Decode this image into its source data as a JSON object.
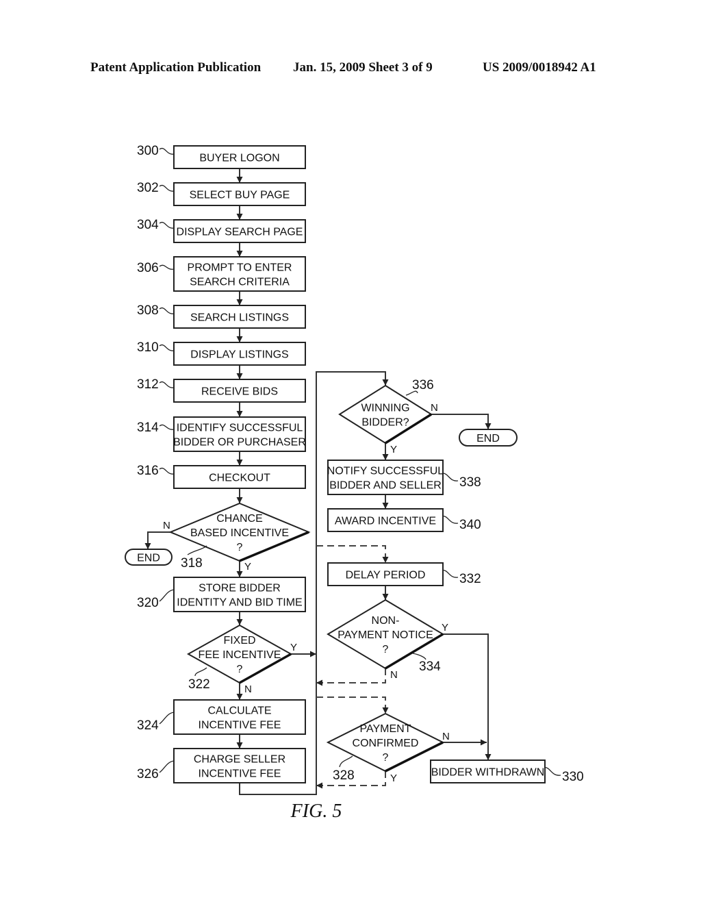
{
  "header": {
    "publication": "Patent Application Publication",
    "date_sheet": "Jan. 15, 2009   Sheet 3 of 9",
    "patent_number": "US 2009/0018942 A1"
  },
  "figure_label": "FIG. 5",
  "nodes": [
    {
      "id": "300",
      "type": "process",
      "lines": [
        "BUYER LOGON"
      ]
    },
    {
      "id": "302",
      "type": "process",
      "lines": [
        "SELECT BUY PAGE"
      ]
    },
    {
      "id": "304",
      "type": "process",
      "lines": [
        "DISPLAY SEARCH PAGE"
      ]
    },
    {
      "id": "306",
      "type": "process",
      "lines": [
        "PROMPT TO ENTER",
        "SEARCH CRITERIA"
      ]
    },
    {
      "id": "308",
      "type": "process",
      "lines": [
        "SEARCH LISTINGS"
      ]
    },
    {
      "id": "310",
      "type": "process",
      "lines": [
        "DISPLAY LISTINGS"
      ]
    },
    {
      "id": "312",
      "type": "process",
      "lines": [
        "RECEIVE BIDS"
      ]
    },
    {
      "id": "314",
      "type": "process",
      "lines": [
        "IDENTIFY SUCCESSFUL",
        "BIDDER OR PURCHASER"
      ]
    },
    {
      "id": "316",
      "type": "process",
      "lines": [
        "CHECKOUT"
      ]
    },
    {
      "id": "318",
      "type": "decision",
      "lines": [
        "CHANCE",
        "BASED INCENTIVE",
        "?"
      ]
    },
    {
      "id": "320",
      "type": "process",
      "lines": [
        "STORE BIDDER",
        "IDENTITY AND BID TIME"
      ]
    },
    {
      "id": "322",
      "type": "decision",
      "lines": [
        "FIXED",
        "FEE INCENTIVE",
        "?"
      ]
    },
    {
      "id": "324",
      "type": "process",
      "lines": [
        "CALCULATE",
        "INCENTIVE FEE"
      ]
    },
    {
      "id": "326",
      "type": "process",
      "lines": [
        "CHARGE SELLER",
        "INCENTIVE FEE"
      ]
    },
    {
      "id": "336",
      "type": "decision",
      "lines": [
        "WINNING",
        "BIDDER?"
      ]
    },
    {
      "id": "338",
      "type": "process",
      "lines": [
        "NOTIFY SUCCESSFUL",
        "BIDDER AND SELLER"
      ]
    },
    {
      "id": "340",
      "type": "process",
      "lines": [
        "AWARD INCENTIVE"
      ]
    },
    {
      "id": "332",
      "type": "process",
      "lines": [
        "DELAY PERIOD"
      ]
    },
    {
      "id": "334",
      "type": "decision",
      "lines": [
        "NON-",
        "PAYMENT NOTICE",
        "?"
      ]
    },
    {
      "id": "328",
      "type": "decision",
      "lines": [
        "PAYMENT",
        "CONFIRMED",
        "?"
      ]
    },
    {
      "id": "330",
      "type": "process",
      "lines": [
        "BIDDER WITHDRAWN"
      ]
    },
    {
      "id": "end-1",
      "type": "terminal",
      "lines": [
        "END"
      ]
    },
    {
      "id": "end-2",
      "type": "terminal",
      "lines": [
        "END"
      ]
    }
  ],
  "branch_labels": {
    "yes": "Y",
    "no": "N"
  },
  "edges": [
    {
      "from": "300",
      "to": "302",
      "style": "solid"
    },
    {
      "from": "302",
      "to": "304",
      "style": "solid"
    },
    {
      "from": "304",
      "to": "306",
      "style": "solid"
    },
    {
      "from": "306",
      "to": "308",
      "style": "solid"
    },
    {
      "from": "308",
      "to": "310",
      "style": "solid"
    },
    {
      "from": "310",
      "to": "312",
      "style": "solid"
    },
    {
      "from": "312",
      "to": "314",
      "style": "solid"
    },
    {
      "from": "314",
      "to": "316",
      "style": "solid"
    },
    {
      "from": "316",
      "to": "318",
      "style": "solid"
    },
    {
      "from": "318",
      "to": "end-1",
      "label": "N",
      "style": "solid"
    },
    {
      "from": "318",
      "to": "320",
      "label": "Y",
      "style": "solid"
    },
    {
      "from": "320",
      "to": "322",
      "style": "solid"
    },
    {
      "from": "322",
      "to": "bus",
      "label": "Y",
      "style": "solid"
    },
    {
      "from": "322",
      "to": "324",
      "label": "N",
      "style": "solid"
    },
    {
      "from": "324",
      "to": "326",
      "style": "solid"
    },
    {
      "from": "326",
      "to": "bus",
      "style": "solid"
    },
    {
      "from": "bus",
      "to": "336",
      "style": "solid"
    },
    {
      "from": "336",
      "to": "end-2",
      "label": "N",
      "style": "solid"
    },
    {
      "from": "336",
      "to": "338",
      "label": "Y",
      "style": "solid"
    },
    {
      "from": "338",
      "to": "340",
      "style": "solid"
    },
    {
      "from": "bus",
      "to": "332",
      "style": "dashed"
    },
    {
      "from": "332",
      "to": "334",
      "style": "solid"
    },
    {
      "from": "334",
      "to": "330",
      "label": "Y",
      "style": "solid"
    },
    {
      "from": "334",
      "to": "bus",
      "label": "N",
      "style": "dashed"
    },
    {
      "from": "bus",
      "to": "328",
      "style": "dashed"
    },
    {
      "from": "328",
      "to": "330",
      "label": "N",
      "style": "solid"
    },
    {
      "from": "328",
      "to": "bus",
      "label": "Y",
      "style": "dashed"
    }
  ]
}
